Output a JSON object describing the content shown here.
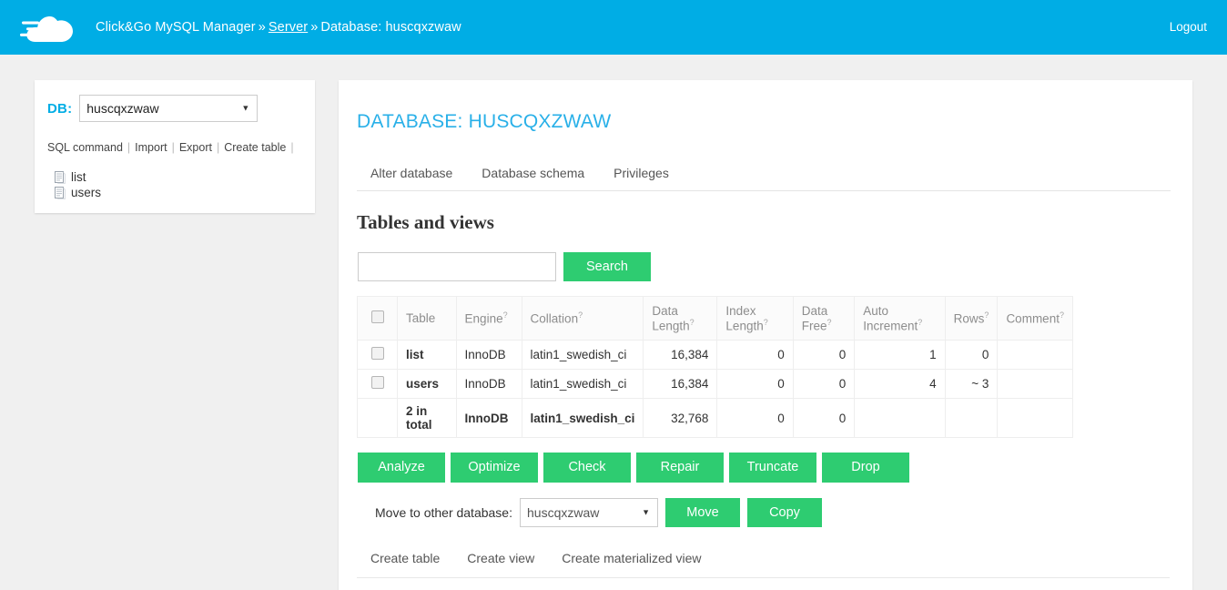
{
  "topbar": {
    "logo_icon": "cloud-with-speed-lines-logo",
    "breadcrumb_app": "Click&Go MySQL Manager",
    "sep1": "»",
    "breadcrumb_server": "Server",
    "sep2": "»",
    "breadcrumb_database": "Database: huscqxzwaw",
    "logout_label": "Logout",
    "bg_color": "#00ade5"
  },
  "sidebar": {
    "db_label": "DB:",
    "db_selected": "huscqxzwaw",
    "caret": "▼",
    "links": [
      {
        "label": "SQL command"
      },
      {
        "label": "Import"
      },
      {
        "label": "Export"
      },
      {
        "label": "Create table"
      }
    ],
    "link_separator": "|",
    "tables": [
      {
        "name": "list",
        "icon": "table-document-icon"
      },
      {
        "name": "users",
        "icon": "table-document-icon"
      }
    ]
  },
  "main": {
    "page_title": "DATABASE: HUSCQXZWAW",
    "tabs": [
      {
        "label": "Alter database"
      },
      {
        "label": "Database schema"
      },
      {
        "label": "Privileges"
      }
    ],
    "section_title": "Tables and views",
    "search": {
      "value": "",
      "placeholder": "",
      "button_label": "Search"
    },
    "table": {
      "help_marker": "?",
      "headers": [
        {
          "label": "",
          "help": false,
          "kind": "checkbox"
        },
        {
          "label": "Table",
          "help": false
        },
        {
          "label": "Engine",
          "help": true
        },
        {
          "label": "Collation",
          "help": true
        },
        {
          "label": "Data Length",
          "help": true
        },
        {
          "label": "Index Length",
          "help": true
        },
        {
          "label": "Data Free",
          "help": true
        },
        {
          "label": "Auto Increment",
          "help": true
        },
        {
          "label": "Rows",
          "help": true
        },
        {
          "label": "Comment",
          "help": true
        }
      ],
      "rows": [
        {
          "name": "list",
          "engine": "InnoDB",
          "collation": "latin1_swedish_ci",
          "data_length": "16,384",
          "index_length": "0",
          "data_free": "0",
          "auto_increment": "1",
          "rows": "0",
          "comment": ""
        },
        {
          "name": "users",
          "engine": "InnoDB",
          "collation": "latin1_swedish_ci",
          "data_length": "16,384",
          "index_length": "0",
          "data_free": "0",
          "auto_increment": "4",
          "rows": "~ 3",
          "comment": ""
        }
      ],
      "total_row": {
        "name": "2 in total",
        "engine": "InnoDB",
        "collation": "latin1_swedish_ci",
        "data_length": "32,768",
        "index_length": "0",
        "data_free": "0",
        "auto_increment": "",
        "rows": "",
        "comment": ""
      }
    },
    "actions": [
      {
        "label": "Analyze"
      },
      {
        "label": "Optimize"
      },
      {
        "label": "Check"
      },
      {
        "label": "Repair"
      },
      {
        "label": "Truncate"
      },
      {
        "label": "Drop"
      }
    ],
    "move": {
      "label": "Move to other database:",
      "selected": "huscqxzwaw",
      "caret": "▼",
      "move_label": "Move",
      "copy_label": "Copy"
    },
    "bottom_links": [
      {
        "label": "Create table"
      },
      {
        "label": "Create view"
      },
      {
        "label": "Create materialized view"
      }
    ]
  },
  "theme": {
    "accent_blue": "#00ade5",
    "title_blue": "#29b0e8",
    "button_green": "#2ecc71",
    "page_bg": "#f0f0f0",
    "panel_bg": "#ffffff"
  }
}
